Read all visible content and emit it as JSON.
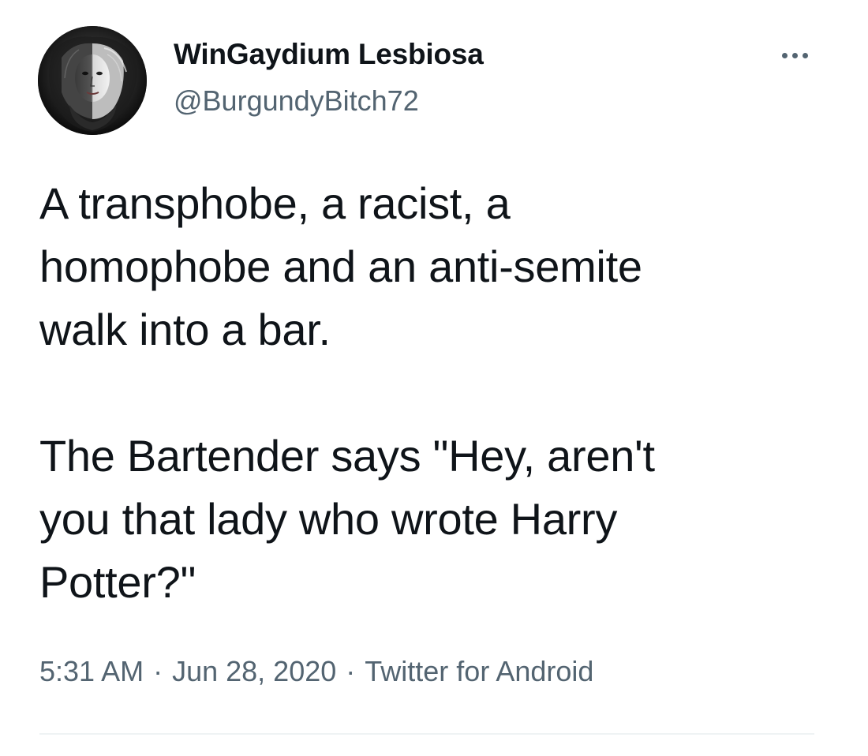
{
  "user": {
    "display_name": "WinGaydium Lesbiosa",
    "handle": "@BurgundyBitch72",
    "avatar_icon": "avatar-image"
  },
  "menu": {
    "icon": "more-horizontal-icon"
  },
  "tweet": {
    "lines_1": [
      "A transphobe, a racist, a",
      "homophobe and an anti-semite",
      "walk into a bar."
    ],
    "lines_2": [
      "The Bartender says \"Hey, aren't",
      "you that lady who wrote Harry",
      "Potter?\""
    ]
  },
  "meta": {
    "time": "5:31 AM",
    "separator": "·",
    "date": "Jun 28, 2020",
    "source": "Twitter for Android"
  },
  "colors": {
    "text": "#0f1419",
    "secondary": "#536471",
    "divider": "#eff3f4"
  }
}
